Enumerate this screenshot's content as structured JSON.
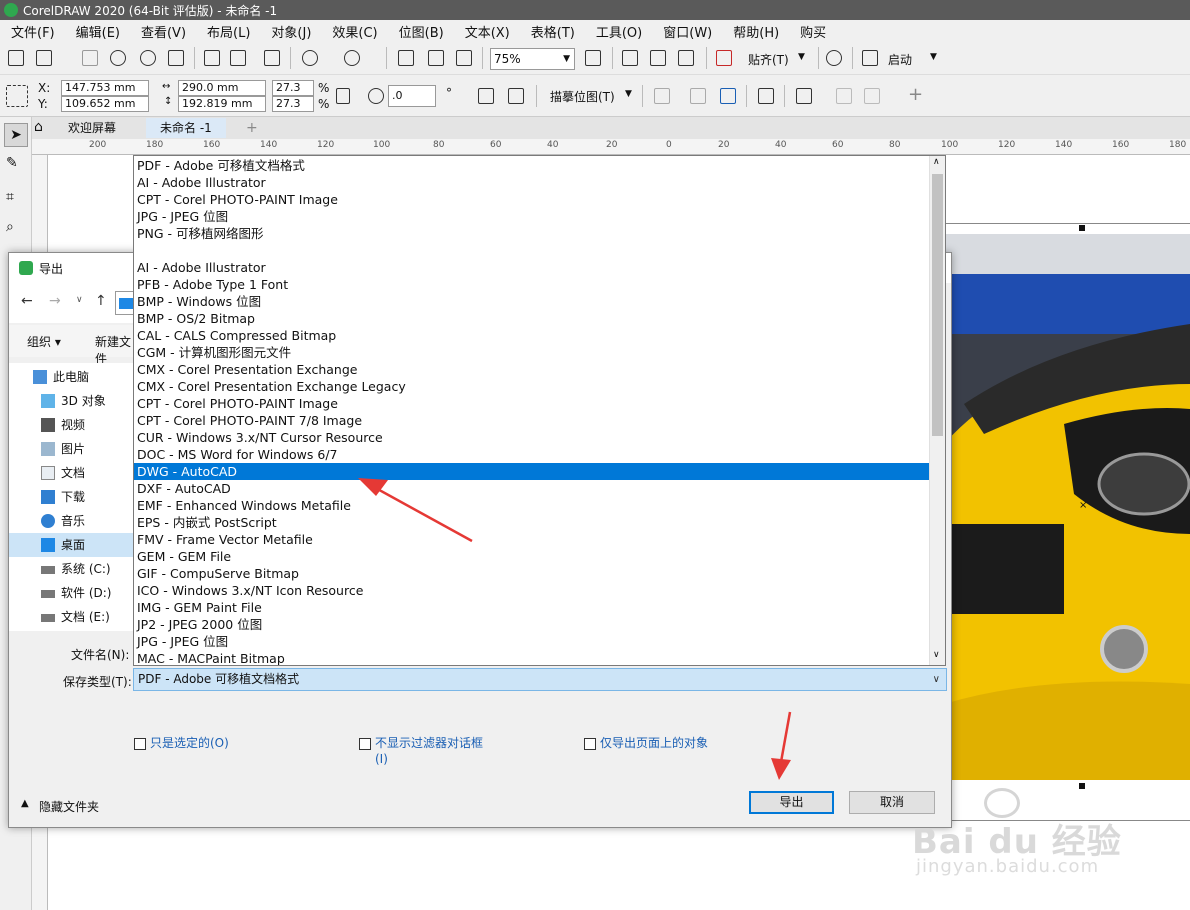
{
  "app": {
    "title": "CorelDRAW 2020 (64-Bit 评估版) - 未命名 -1",
    "menu": [
      "文件(F)",
      "编辑(E)",
      "查看(V)",
      "布局(L)",
      "对象(J)",
      "效果(C)",
      "位图(B)",
      "文本(X)",
      "表格(T)",
      "工具(O)",
      "窗口(W)",
      "帮助(H)",
      "购买"
    ],
    "zoom": "75%",
    "snap_label": "贴齐(T)",
    "launch_label": "启动",
    "brand_color": "#2fa84f"
  },
  "props": {
    "x_label": "X:",
    "y_label": "Y:",
    "x_value": "147.753 mm",
    "y_value": "109.652 mm",
    "w_value": "290.0 mm",
    "h_value": "192.819 mm",
    "scale_x": "27.3",
    "scale_y": "27.3",
    "percent": "%",
    "angle": ".0",
    "degree": "°",
    "trace_label": "描摹位图(T)"
  },
  "tabs": {
    "welcome": "欢迎屏幕",
    "doc": "未命名 -1",
    "add": "+"
  },
  "ruler": [
    "200",
    "180",
    "160",
    "140",
    "120",
    "100",
    "80",
    "60",
    "40",
    "20",
    "0",
    "20",
    "40",
    "60",
    "80",
    "100",
    "120",
    "140",
    "160",
    "180"
  ],
  "dialog": {
    "title": "导出",
    "organize": "组织 ▾",
    "new_folder": "新建文件",
    "tree": [
      {
        "label": "此电脑",
        "icon": "computer-icon"
      },
      {
        "label": "3D 对象",
        "icon": "cube-icon"
      },
      {
        "label": "视频",
        "icon": "video-icon"
      },
      {
        "label": "图片",
        "icon": "picture-icon"
      },
      {
        "label": "文档",
        "icon": "document-icon"
      },
      {
        "label": "下载",
        "icon": "download-icon"
      },
      {
        "label": "音乐",
        "icon": "music-icon"
      },
      {
        "label": "桌面",
        "icon": "desktop-icon"
      },
      {
        "label": "系统 (C:)",
        "icon": "drive-icon"
      },
      {
        "label": "软件 (D:)",
        "icon": "drive-icon"
      },
      {
        "label": "文档 (E:)",
        "icon": "drive-icon"
      }
    ],
    "filename_label": "文件名(N):",
    "savetype_label": "保存类型(T):",
    "savetype_value": "PDF - Adobe 可移植文档格式",
    "checkbox_selected_only": "只是选定的(O)",
    "checkbox_no_filter_1": "不显示过滤器对话框",
    "checkbox_no_filter_2": "(I)",
    "checkbox_page_only": "仅导出页面上的对象",
    "hide_folders": "隐藏文件夹",
    "export_button": "导出",
    "cancel_button": "取消"
  },
  "typelist": {
    "selected_index": 18,
    "items": [
      "PDF - Adobe 可移植文档格式",
      "AI - Adobe Illustrator",
      "CPT - Corel PHOTO-PAINT Image",
      "JPG - JPEG 位图",
      "PNG - 可移植网络图形",
      "",
      "AI - Adobe Illustrator",
      "PFB - Adobe Type 1 Font",
      "BMP - Windows 位图",
      "BMP - OS/2 Bitmap",
      "CAL - CALS Compressed Bitmap",
      "CGM - 计算机图形图元文件",
      "CMX - Corel Presentation Exchange",
      "CMX - Corel Presentation Exchange Legacy",
      "CPT - Corel PHOTO-PAINT Image",
      "CPT - Corel PHOTO-PAINT 7/8 Image",
      "CUR - Windows 3.x/NT Cursor Resource",
      "DOC - MS Word for Windows 6/7",
      "DWG - AutoCAD",
      "DXF - AutoCAD",
      "EMF - Enhanced Windows Metafile",
      "EPS - 内嵌式 PostScript",
      "FMV - Frame Vector Metafile",
      "GEM - GEM File",
      "GIF - CompuServe Bitmap",
      "ICO - Windows 3.x/NT Icon Resource",
      "IMG - GEM Paint File",
      "JP2 - JPEG 2000 位图",
      "JPG - JPEG 位图",
      "MAC - MACPaint Bitmap"
    ]
  },
  "watermark": {
    "brand": "Bai du 经验",
    "url": "jingyan.baidu.com"
  },
  "colors": {
    "selection": "#0078d7",
    "arrow": "#e53935",
    "car_yellow": "#f2c200"
  }
}
